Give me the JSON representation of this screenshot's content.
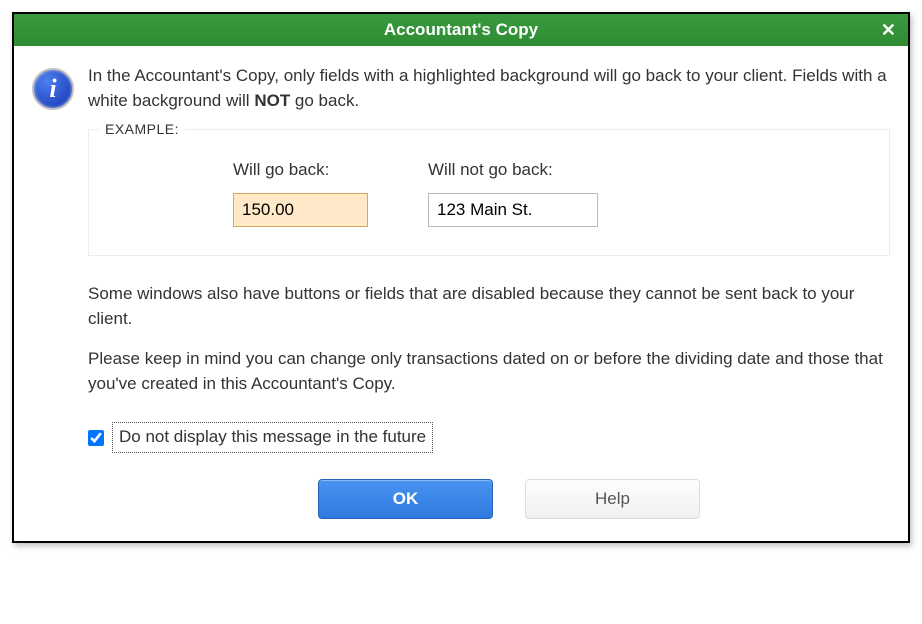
{
  "titlebar": {
    "title": "Accountant's Copy"
  },
  "message": {
    "intro_part1": "In the Accountant's Copy, only fields with a highlighted background will go back to your client. Fields with a white background will ",
    "intro_bold": "NOT",
    "intro_part2": " go back."
  },
  "example": {
    "legend": "EXAMPLE:",
    "will_go_back_label": "Will go back:",
    "will_go_back_value": "150.00",
    "will_not_go_back_label": "Will not go back:",
    "will_not_go_back_value": "123 Main St."
  },
  "message2": "Some windows also have buttons or fields that are disabled because they cannot be sent back to your client.",
  "message3": "Please keep in mind you can change only transactions dated on or before the dividing date and those that you've created in this Accountant's Copy.",
  "checkbox": {
    "label": "Do not display this message in the future",
    "checked": true
  },
  "buttons": {
    "ok": "OK",
    "help": "Help"
  }
}
